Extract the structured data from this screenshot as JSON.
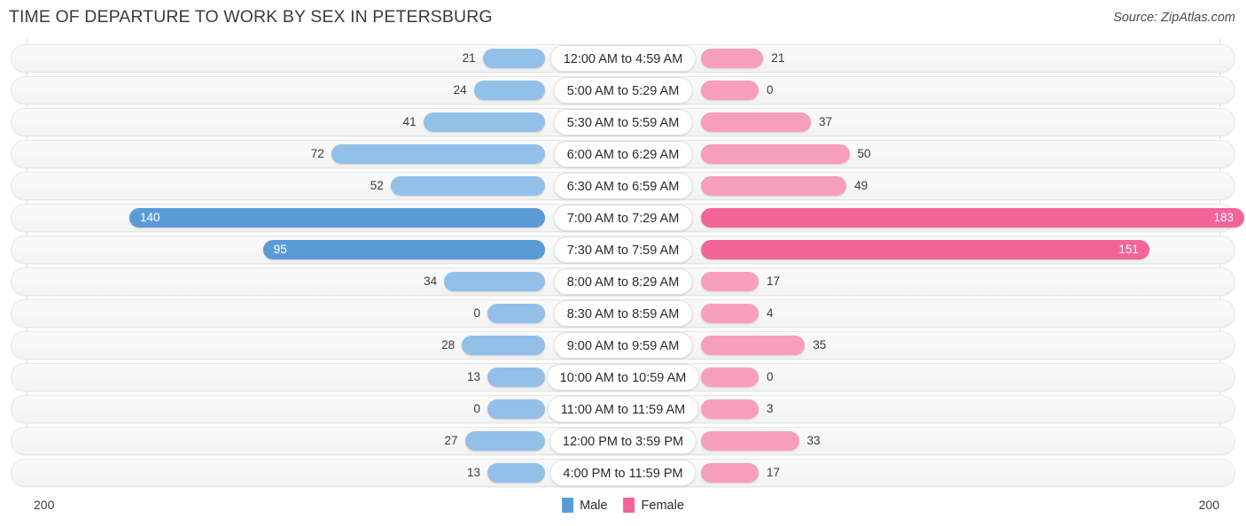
{
  "header": {
    "title": "TIME OF DEPARTURE TO WORK BY SEX IN PETERSBURG",
    "source": "Source: ZipAtlas.com"
  },
  "axis": {
    "left_max_label": "200",
    "right_max_label": "200"
  },
  "legend": {
    "items": [
      {
        "label": "Male",
        "color": "#5b9bd5"
      },
      {
        "label": "Female",
        "color": "#f2649a"
      }
    ]
  },
  "colors": {
    "male_light": "#93c0e8",
    "male_dark": "#5b9bd5",
    "female_light": "#f79ebd",
    "female_dark": "#f2649a",
    "track": "#f7f7f7",
    "gridline": "#e2e2e2",
    "title": "#3c3c3c"
  },
  "chart_data": {
    "type": "bar",
    "orientation": "horizontal-diverging",
    "title": "TIME OF DEPARTURE TO WORK BY SEX IN PETERSBURG",
    "xlabel": "",
    "ylabel": "",
    "xlim": [
      200,
      200
    ],
    "axis_max": 200,
    "grid": true,
    "legend_position": "bottom-center",
    "categories": [
      "12:00 AM to 4:59 AM",
      "5:00 AM to 5:29 AM",
      "5:30 AM to 5:59 AM",
      "6:00 AM to 6:29 AM",
      "6:30 AM to 6:59 AM",
      "7:00 AM to 7:29 AM",
      "7:30 AM to 7:59 AM",
      "8:00 AM to 8:29 AM",
      "8:30 AM to 8:59 AM",
      "9:00 AM to 9:59 AM",
      "10:00 AM to 10:59 AM",
      "11:00 AM to 11:59 AM",
      "12:00 PM to 3:59 PM",
      "4:00 PM to 11:59 PM"
    ],
    "series": [
      {
        "name": "Male",
        "side": "left",
        "values": [
          21,
          24,
          41,
          72,
          52,
          140,
          95,
          34,
          0,
          28,
          13,
          0,
          27,
          13
        ]
      },
      {
        "name": "Female",
        "side": "right",
        "values": [
          21,
          0,
          37,
          50,
          49,
          183,
          151,
          17,
          4,
          35,
          0,
          3,
          33,
          17
        ]
      }
    ]
  }
}
